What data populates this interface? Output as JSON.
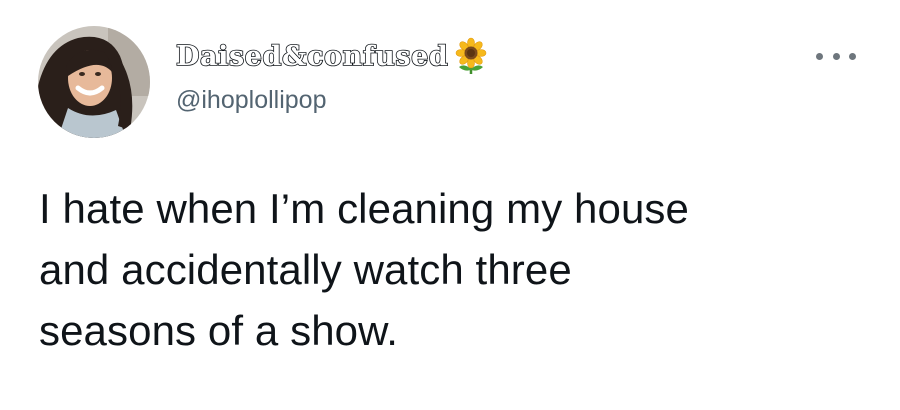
{
  "tweet": {
    "author": {
      "display_name": "Daised&confused",
      "name_emoji_icon": "sunflower-icon",
      "handle": "@ihoplollipop",
      "avatar": "avatar"
    },
    "more_options_icon": "more-options-icon",
    "text": "I hate when I’m cleaning my house\nand accidentally watch three\nseasons of a show."
  }
}
